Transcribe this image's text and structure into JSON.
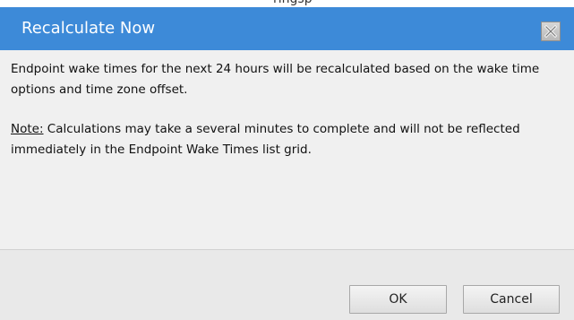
{
  "top_strip": {
    "text": "ringsp"
  },
  "dialog": {
    "title": "Recalculate Now",
    "close_label": "X",
    "body": {
      "paragraph1": "Endpoint wake times for the next 24 hours will be recalculated based on the wake time options and time zone offset.",
      "note_label": "Note:",
      "note_text": " Calculations may take a several minutes to complete and will not be reflected immediately in the Endpoint Wake Times list grid."
    },
    "buttons": {
      "ok_label": "OK",
      "cancel_label": "Cancel"
    }
  },
  "colors": {
    "title_bar": "#3d8ad8",
    "dialog_background": "#f0f0f0",
    "footer_background": "#e9e9e9"
  },
  "icons": {
    "close": "close-icon"
  }
}
